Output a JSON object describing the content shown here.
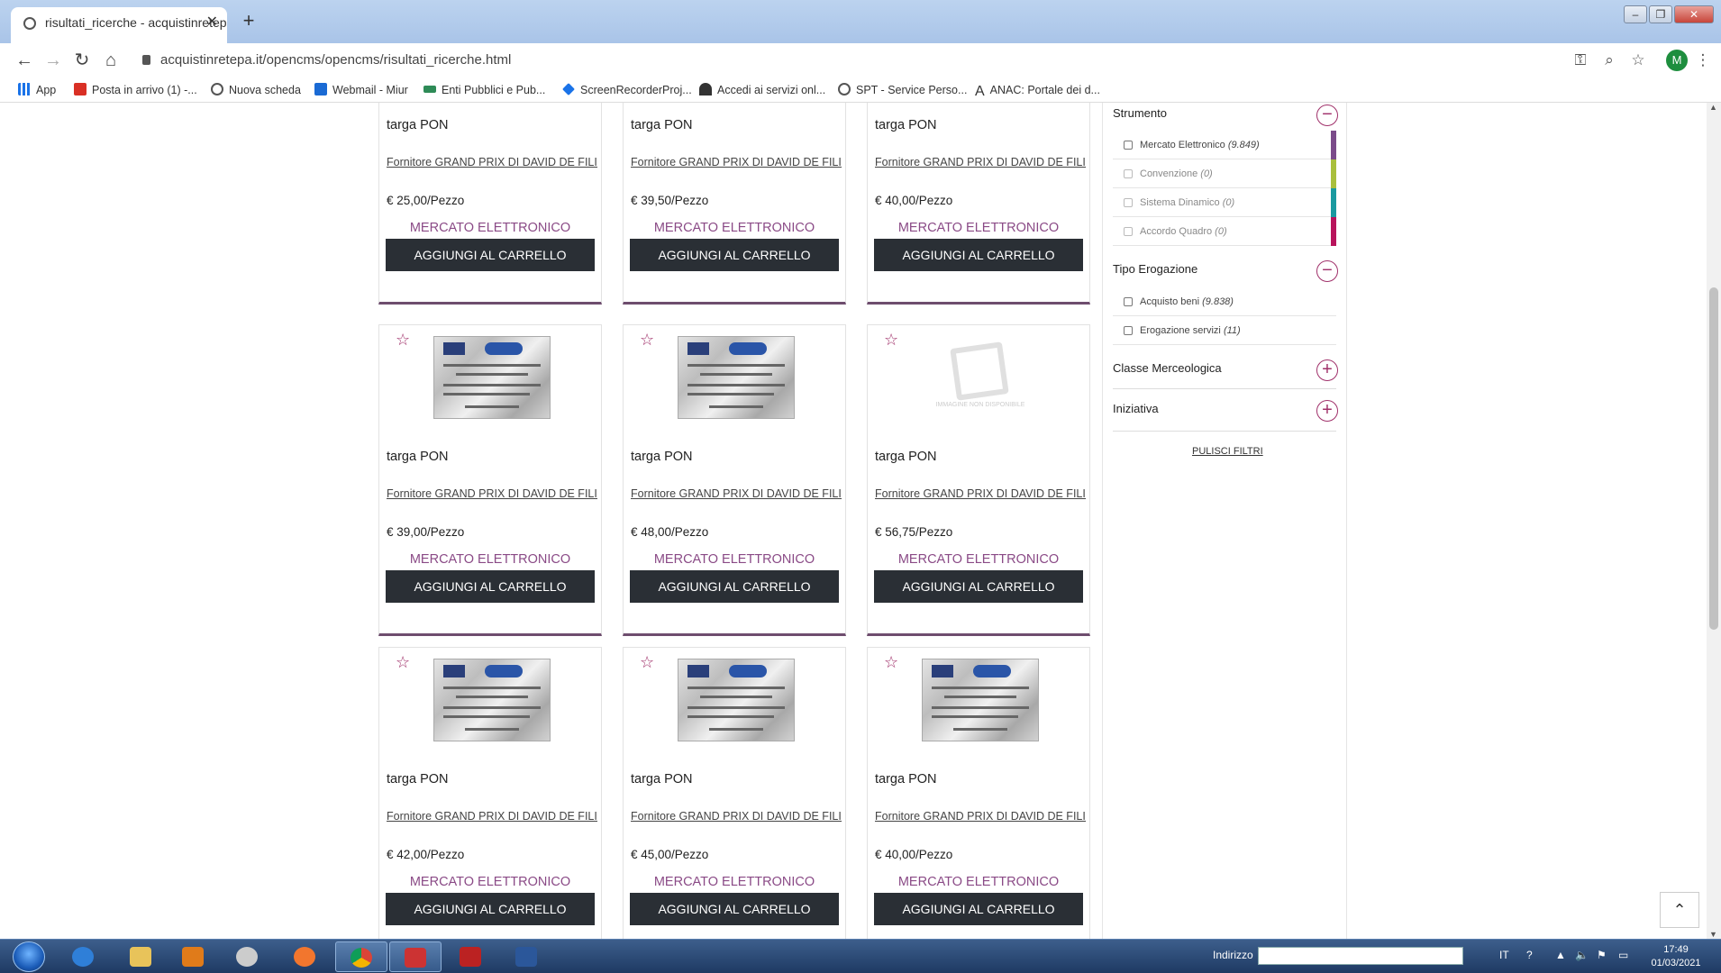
{
  "browser": {
    "tab_title": "risultati_ricerche - acquistinretep",
    "url": "acquistinretepa.it/opencms/opencms/risultati_ricerche.html",
    "avatar_letter": "M",
    "bookmarks": [
      "App",
      "Posta in arrivo (1) -...",
      "Nuova scheda",
      "Webmail - Miur",
      "Enti Pubblici e Pub...",
      "ScreenRecorderProj...",
      "Accedi ai servizi onl...",
      "SPT - Service Perso...",
      "ANAC: Portale dei d..."
    ]
  },
  "products": [
    {
      "title": "targa PON",
      "supplier": "Fornitore GRAND PRIX DI DAVID DE FILIPPI",
      "price": "€ 25,00/Pezzo",
      "market": "MERCATO ELETTRONICO",
      "cart": "AGGIUNGI AL CARRELLO",
      "image": "plaque"
    },
    {
      "title": "targa PON",
      "supplier": "Fornitore GRAND PRIX DI DAVID DE FILIPPI",
      "price": "€ 39,50/Pezzo",
      "market": "MERCATO ELETTRONICO",
      "cart": "AGGIUNGI AL CARRELLO",
      "image": "plaque"
    },
    {
      "title": "targa PON",
      "supplier": "Fornitore GRAND PRIX DI DAVID DE FILIPPI",
      "price": "€ 40,00/Pezzo",
      "market": "MERCATO ELETTRONICO",
      "cart": "AGGIUNGI AL CARRELLO",
      "image": "plaque"
    },
    {
      "title": "targa PON",
      "supplier": "Fornitore GRAND PRIX DI DAVID DE FILIPPI",
      "price": "€ 39,00/Pezzo",
      "market": "MERCATO ELETTRONICO",
      "cart": "AGGIUNGI AL CARRELLO",
      "image": "plaque"
    },
    {
      "title": "targa PON",
      "supplier": "Fornitore GRAND PRIX DI DAVID DE FILIPPI",
      "price": "€ 48,00/Pezzo",
      "market": "MERCATO ELETTRONICO",
      "cart": "AGGIUNGI AL CARRELLO",
      "image": "plaque"
    },
    {
      "title": "targa PON",
      "supplier": "Fornitore GRAND PRIX DI DAVID DE FILIPPI",
      "price": "€ 56,75/Pezzo",
      "market": "MERCATO ELETTRONICO",
      "cart": "AGGIUNGI AL CARRELLO",
      "image": "placeholder"
    },
    {
      "title": "targa PON",
      "supplier": "Fornitore GRAND PRIX DI DAVID DE FILIPPI",
      "price": "€ 42,00/Pezzo",
      "market": "MERCATO ELETTRONICO",
      "cart": "AGGIUNGI AL CARRELLO",
      "image": "plaque"
    },
    {
      "title": "targa PON",
      "supplier": "Fornitore GRAND PRIX DI DAVID DE FILIPPI",
      "price": "€ 45,00/Pezzo",
      "market": "MERCATO ELETTRONICO",
      "cart": "AGGIUNGI AL CARRELLO",
      "image": "plaque"
    },
    {
      "title": "targa PON",
      "supplier": "Fornitore GRAND PRIX DI DAVID DE FILIPPI",
      "price": "€ 40,00/Pezzo",
      "market": "MERCATO ELETTRONICO",
      "cart": "AGGIUNGI AL CARRELLO",
      "image": "plaque"
    }
  ],
  "filters": {
    "strumento": {
      "title": "Strumento",
      "toggle": "−",
      "options": [
        {
          "label": "Mercato Elettronico",
          "count": "(9.849)",
          "color": "#7b4b8a",
          "disabled": false
        },
        {
          "label": "Convenzione",
          "count": "(0)",
          "color": "#a9bf3c",
          "disabled": true
        },
        {
          "label": "Sistema Dinamico",
          "count": "(0)",
          "color": "#1a9aa0",
          "disabled": true
        },
        {
          "label": "Accordo Quadro",
          "count": "(0)",
          "color": "#b8145c",
          "disabled": true
        }
      ]
    },
    "tipo_erogazione": {
      "title": "Tipo Erogazione",
      "toggle": "−",
      "options": [
        {
          "label": "Acquisto beni",
          "count": "(9.838)",
          "disabled": false
        },
        {
          "label": "Erogazione servizi",
          "count": "(11)",
          "disabled": false
        }
      ]
    },
    "classe": {
      "title": "Classe Merceologica",
      "toggle": "+"
    },
    "iniziativa": {
      "title": "Iniziativa",
      "toggle": "+"
    },
    "clear_label": "PULISCI FILTRI"
  },
  "placeholder_text": "IMMAGINE NON DISPONIBILE",
  "taskbar": {
    "address_label": "Indirizzo",
    "lang": "IT",
    "time": "17:49",
    "date": "01/03/2021"
  },
  "colors": {
    "accent": "#a0306a",
    "market": "#8a4a86",
    "button": "#2a2f35"
  }
}
